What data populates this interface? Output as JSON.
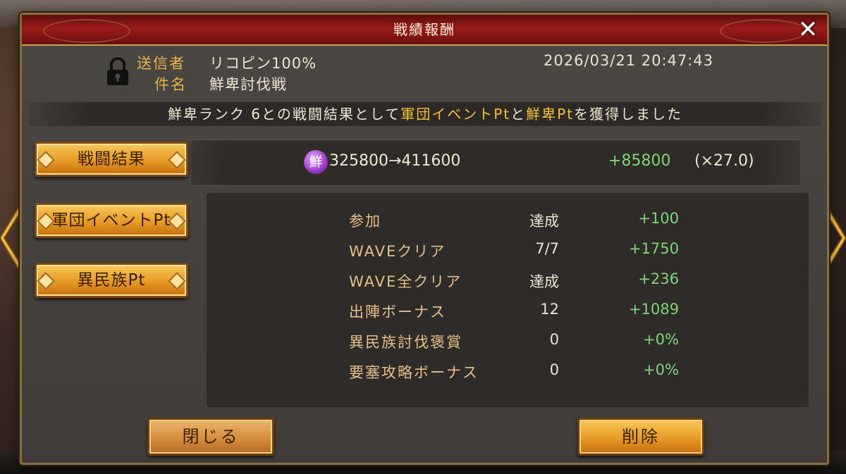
{
  "dialog": {
    "title": "戦績報酬",
    "close_glyph": "✕"
  },
  "header": {
    "sender_label": "送信者",
    "sender_value": "リコピン100%",
    "subject_label": "件名",
    "subject_value": "鮮卑討伐戦",
    "datetime": "2026/03/21  20:47:43"
  },
  "banner": {
    "part1": "鮮卑ランク 6との戦闘結果として",
    "highlight1": "軍団イベントPt",
    "part2": "と",
    "highlight2": "鮮卑Pt",
    "part3": "を獲得しました",
    "highlight_color": "#f3c23a"
  },
  "side_tabs": [
    {
      "label": "戦闘結果"
    },
    {
      "label": "軍団イベントPt"
    },
    {
      "label": "異民族Pt"
    }
  ],
  "score": {
    "badge_glyph": "鮮",
    "progress": "325800→411600",
    "gain": "+85800",
    "multiplier": "(×27.0)"
  },
  "details": [
    {
      "label": "参加",
      "condition": "達成",
      "value": "+100"
    },
    {
      "label": "WAVEクリア",
      "condition": "7/7",
      "value": "+1750"
    },
    {
      "label": "WAVE全クリア",
      "condition": "達成",
      "value": "+236"
    },
    {
      "label": "出陣ボーナス",
      "condition": "12",
      "value": "+1089"
    },
    {
      "label": "異民族討伐褒賞",
      "condition": "0",
      "value": "+0%"
    },
    {
      "label": "要塞攻略ボーナス",
      "condition": "0",
      "value": "+0%"
    }
  ],
  "buttons": {
    "close_label": "閉じる",
    "delete_label": "削除"
  },
  "icons": {
    "lock": "lock-icon",
    "close": "close-icon",
    "nav_left": "chevron-left-icon",
    "nav_right": "chevron-right-icon",
    "badge": "xianbei-pt-icon"
  },
  "colors": {
    "accent_gold": "#e7b24a",
    "gain_green": "#7fd67a",
    "title_red": "#9a1b17"
  }
}
